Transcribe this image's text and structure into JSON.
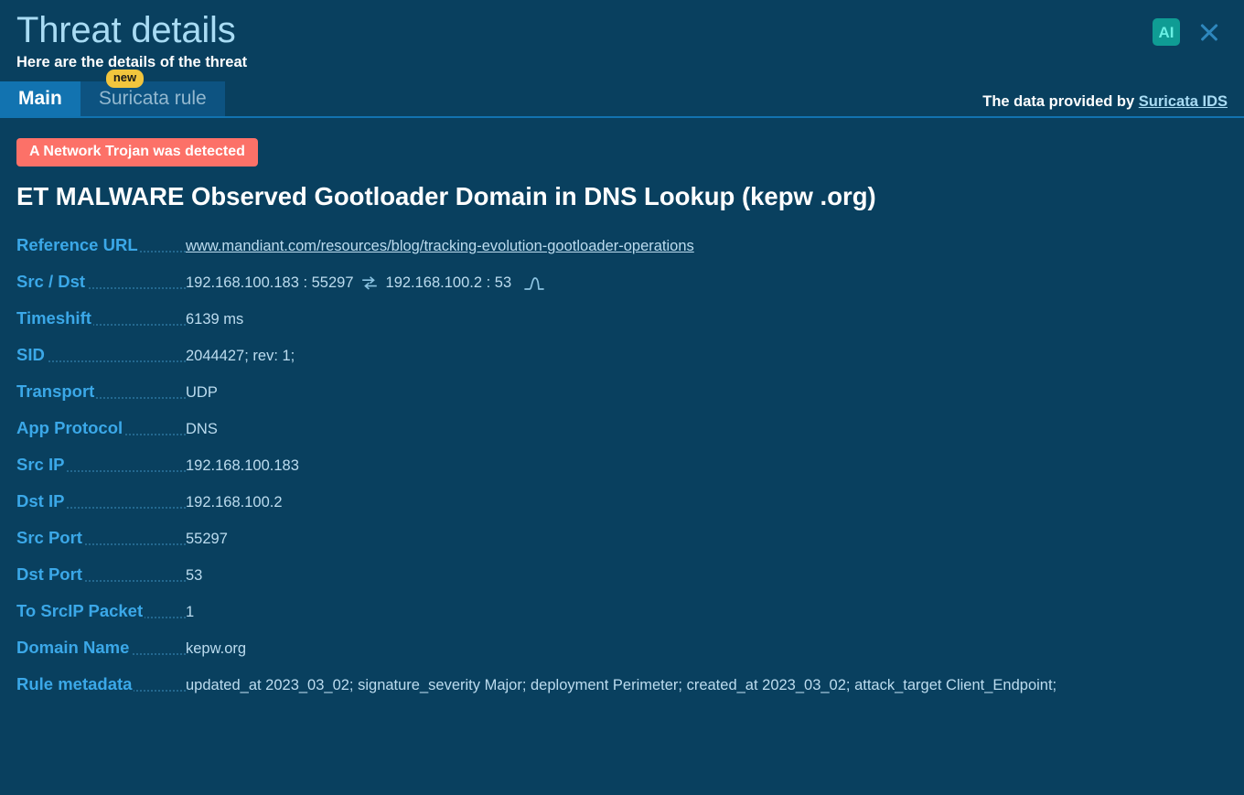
{
  "header": {
    "title": "Threat details",
    "subtitle": "Here are the details of the threat",
    "ai_badge_label": "AI",
    "close_label": "Close"
  },
  "tabs": [
    {
      "label": "Main",
      "active": true,
      "badge": null
    },
    {
      "label": "Suricata rule",
      "active": false,
      "badge": "new"
    }
  ],
  "provider": {
    "prefix": "The data provided by ",
    "link_label": "Suricata IDS"
  },
  "threat": {
    "category_badge": "A Network Trojan was detected",
    "signature": "ET MALWARE Observed Gootloader Domain in DNS Lookup (kepw .org)"
  },
  "details": {
    "reference_url_label": "Reference URL",
    "reference_url_value": "www.mandiant.com/resources/blog/tracking-evolution-gootloader-operations",
    "src_dst_label": "Src / Dst",
    "src_dst_src": "192.168.100.183 : 55297",
    "src_dst_dst": "192.168.100.2 : 53",
    "timeshift_label": "Timeshift",
    "timeshift_value": "6139 ms",
    "sid_label": "SID",
    "sid_value": "2044427; rev: 1;",
    "transport_label": "Transport",
    "transport_value": "UDP",
    "app_protocol_label": "App Protocol",
    "app_protocol_value": "DNS",
    "src_ip_label": "Src IP",
    "src_ip_value": "192.168.100.183",
    "dst_ip_label": "Dst IP",
    "dst_ip_value": "192.168.100.2",
    "src_port_label": "Src Port",
    "src_port_value": "55297",
    "dst_port_label": "Dst Port",
    "dst_port_value": "53",
    "to_srcip_packet_label": "To SrcIP Packet",
    "to_srcip_packet_value": "1",
    "domain_name_label": "Domain Name",
    "domain_name_value": "kepw.org",
    "rule_metadata_label": "Rule metadata",
    "rule_metadata_value": "updated_at 2023_03_02; signature_severity Major; deployment Perimeter; created_at 2023_03_02; attack_target Client_Endpoint;"
  },
  "colors": {
    "background": "#09405f",
    "accent_blue": "#1273b0",
    "label_blue": "#3ba8e8",
    "title_blue": "#a9dcf4",
    "value_text": "#bcdcef",
    "threat_red": "#fc7168",
    "badge_yellow": "#f2c53d",
    "ai_teal": "#0f9c94"
  }
}
